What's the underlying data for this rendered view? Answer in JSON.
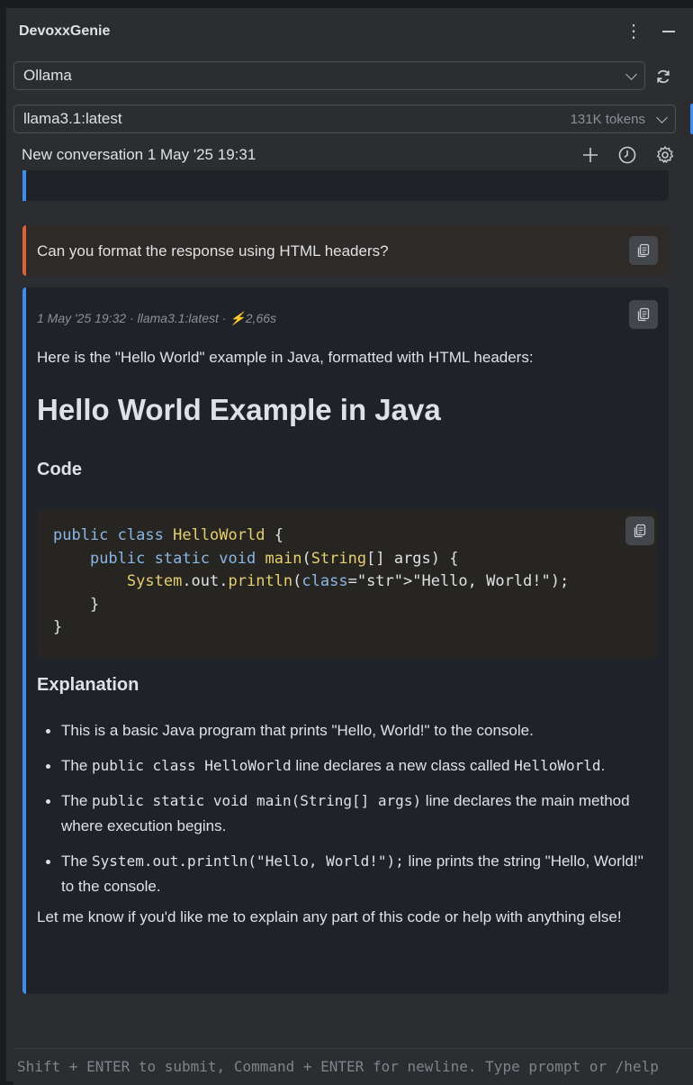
{
  "app": {
    "title": "DevoxxGenie"
  },
  "provider": {
    "selected": "Ollama"
  },
  "model": {
    "selected": "llama3.1:latest",
    "tokens": "131K tokens"
  },
  "conversation": {
    "title": "New conversation 1 May '25 19:31"
  },
  "messages": {
    "user": {
      "text": "Can you format the response using HTML headers?"
    },
    "assistant": {
      "meta": "1 May '25 19:32 · llama3.1:latest · ⚡2,66s",
      "intro": "Here is the \"Hello World\" example in Java, formatted with HTML headers:",
      "heading": "Hello World Example in Java",
      "code_heading": "Code",
      "code_lines": [
        "public class HelloWorld {",
        "    public static void main(String[] args) {",
        "        System.out.println(\"Hello, World!\");",
        "    }",
        "}"
      ],
      "explanation_heading": "Explanation",
      "bullets": {
        "b1": "This is a basic Java program that prints \"Hello, World!\" to the console.",
        "b2_pre": "The ",
        "b2_code": "public class HelloWorld",
        "b2_mid": " line declares a new class called ",
        "b2_code2": "HelloWorld",
        "b2_post": ".",
        "b3_pre": "The ",
        "b3_code": "public static void main(String[] args)",
        "b3_post": " line declares the main method where execution begins.",
        "b4_pre": "The ",
        "b4_code": "System.out.println(\"Hello, World!\");",
        "b4_post": " line prints the string \"Hello, World!\" to the console."
      },
      "outro": "Let me know if you'd like me to explain any part of this code or help with anything else!"
    }
  },
  "input": {
    "placeholder": "Shift + ENTER to submit, Command + ENTER for newline. Type prompt or /help"
  },
  "colors": {
    "accent_blue": "#3d8ef0",
    "user_bar": "#e0603a",
    "background": "#2b2d30"
  },
  "icons": [
    "more-vertical-icon",
    "minimize-icon",
    "chevron-down-icon",
    "refresh-icon",
    "plus-icon",
    "history-icon",
    "gear-icon",
    "copy-icon"
  ]
}
